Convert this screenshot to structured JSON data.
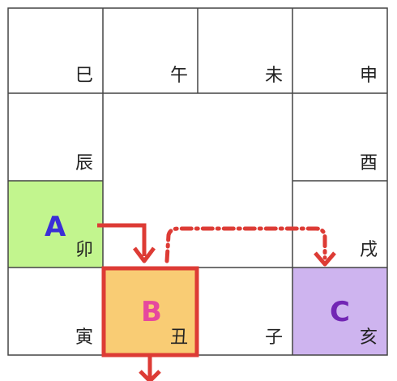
{
  "branches": {
    "si": "巳",
    "wu": "午",
    "wei": "未",
    "shen": "申",
    "chen": "辰",
    "you": "酉",
    "mao": "卯",
    "xu": "戌",
    "yin": "寅",
    "chou": "丑",
    "zi": "子",
    "hai": "亥"
  },
  "markers": {
    "a": "A",
    "b": "B",
    "c": "C"
  },
  "colors": {
    "grid": "#444444",
    "cell_a_fill": "#c2f58e",
    "cell_b_fill": "#f9cc74",
    "cell_b_border": "#dd3b35",
    "cell_c_fill": "#ceb4ef",
    "arrow": "#dd3b35",
    "label_a": "#3b2fd6",
    "label_b": "#e6489e",
    "label_c": "#7226b4"
  }
}
